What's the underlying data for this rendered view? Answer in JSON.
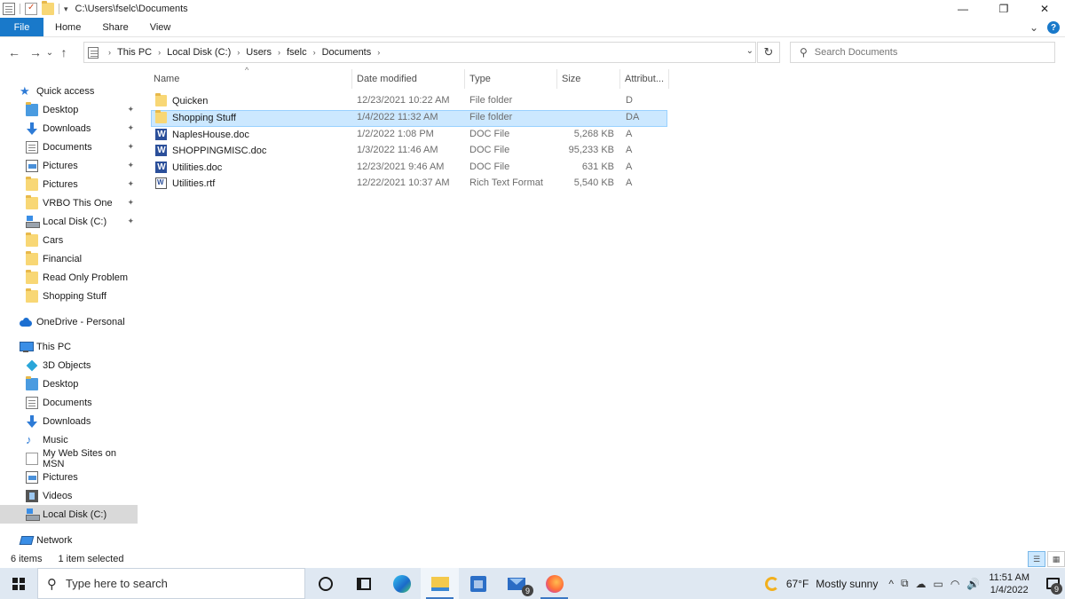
{
  "window": {
    "title": "C:\\Users\\fselc\\Documents",
    "controls": {
      "minimize": "—",
      "maximize": "❐",
      "close": "✕"
    }
  },
  "ribbon": {
    "tabs": [
      "File",
      "Home",
      "Share",
      "View"
    ],
    "help": "?",
    "expand": "⌄"
  },
  "nav": {
    "back": "←",
    "forward": "→",
    "recent": "⌄",
    "up": "↑",
    "breadcrumb": [
      "This PC",
      "Local Disk (C:)",
      "Users",
      "fselc",
      "Documents"
    ],
    "refresh": "↻",
    "search_placeholder": "Search Documents"
  },
  "sidebar": {
    "quick_access": "Quick access",
    "quick_items": [
      {
        "label": "Desktop",
        "icon": "folder-blue-icon",
        "pinned": true
      },
      {
        "label": "Downloads",
        "icon": "download-arrow-icon",
        "pinned": true
      },
      {
        "label": "Documents",
        "icon": "document-icon",
        "pinned": true
      },
      {
        "label": "Pictures",
        "icon": "pictures-icon",
        "pinned": true
      },
      {
        "label": "Pictures",
        "icon": "folder-icon",
        "pinned": true
      },
      {
        "label": "VRBO This One",
        "icon": "folder-icon",
        "pinned": true
      },
      {
        "label": "Local Disk (C:)",
        "icon": "drive-icon",
        "pinned": true
      },
      {
        "label": "Cars",
        "icon": "folder-icon",
        "pinned": false
      },
      {
        "label": "Financial",
        "icon": "folder-icon",
        "pinned": false
      },
      {
        "label": "Read Only Problem",
        "icon": "folder-icon",
        "pinned": false
      },
      {
        "label": "Shopping Stuff",
        "icon": "folder-icon",
        "pinned": false
      }
    ],
    "onedrive": "OneDrive - Personal",
    "this_pc": "This PC",
    "pc_items": [
      {
        "label": "3D Objects",
        "icon": "cube-icon"
      },
      {
        "label": "Desktop",
        "icon": "folder-blue-icon"
      },
      {
        "label": "Documents",
        "icon": "document-icon"
      },
      {
        "label": "Downloads",
        "icon": "download-arrow-icon"
      },
      {
        "label": "Music",
        "icon": "music-icon"
      },
      {
        "label": "My Web Sites on MSN",
        "icon": "page-icon"
      },
      {
        "label": "Pictures",
        "icon": "pictures-icon"
      },
      {
        "label": "Videos",
        "icon": "video-icon"
      },
      {
        "label": "Local Disk (C:)",
        "icon": "drive-icon"
      }
    ],
    "network": "Network",
    "pin_glyph": "📌"
  },
  "columns": [
    "Name",
    "Date modified",
    "Type",
    "Size",
    "Attribut..."
  ],
  "files": [
    {
      "name": "Quicken",
      "date": "12/23/2021 10:22 AM",
      "type": "File folder",
      "size": "",
      "attr": "D",
      "icon": "folder-icon",
      "selected": false
    },
    {
      "name": "Shopping Stuff",
      "date": "1/4/2022 11:32 AM",
      "type": "File folder",
      "size": "",
      "attr": "DA",
      "icon": "folder-icon",
      "selected": true
    },
    {
      "name": "NaplesHouse.doc",
      "date": "1/2/2022 1:08 PM",
      "type": "DOC File",
      "size": "5,268 KB",
      "attr": "A",
      "icon": "word-doc-icon",
      "selected": false
    },
    {
      "name": "SHOPPINGMISC.doc",
      "date": "1/3/2022 11:46 AM",
      "type": "DOC File",
      "size": "95,233 KB",
      "attr": "A",
      "icon": "word-doc-icon",
      "selected": false
    },
    {
      "name": "Utilities.doc",
      "date": "12/23/2021 9:46 AM",
      "type": "DOC File",
      "size": "631 KB",
      "attr": "A",
      "icon": "word-doc-icon",
      "selected": false
    },
    {
      "name": "Utilities.rtf",
      "date": "12/22/2021 10:37 AM",
      "type": "Rich Text Format",
      "size": "5,540 KB",
      "attr": "A",
      "icon": "rtf-doc-icon",
      "selected": false
    }
  ],
  "status": {
    "count": "6 items",
    "selection": "1 item selected"
  },
  "taskbar": {
    "search_placeholder": "Type here to search",
    "mail_badge": "9",
    "weather": "67°F",
    "weather_desc": "Mostly sunny",
    "time": "11:51 AM",
    "date": "1/4/2022",
    "notif_badge": "9",
    "tray_glyphs": [
      "^",
      "⧉",
      "☁",
      "▭",
      "◠",
      "🔊"
    ]
  }
}
